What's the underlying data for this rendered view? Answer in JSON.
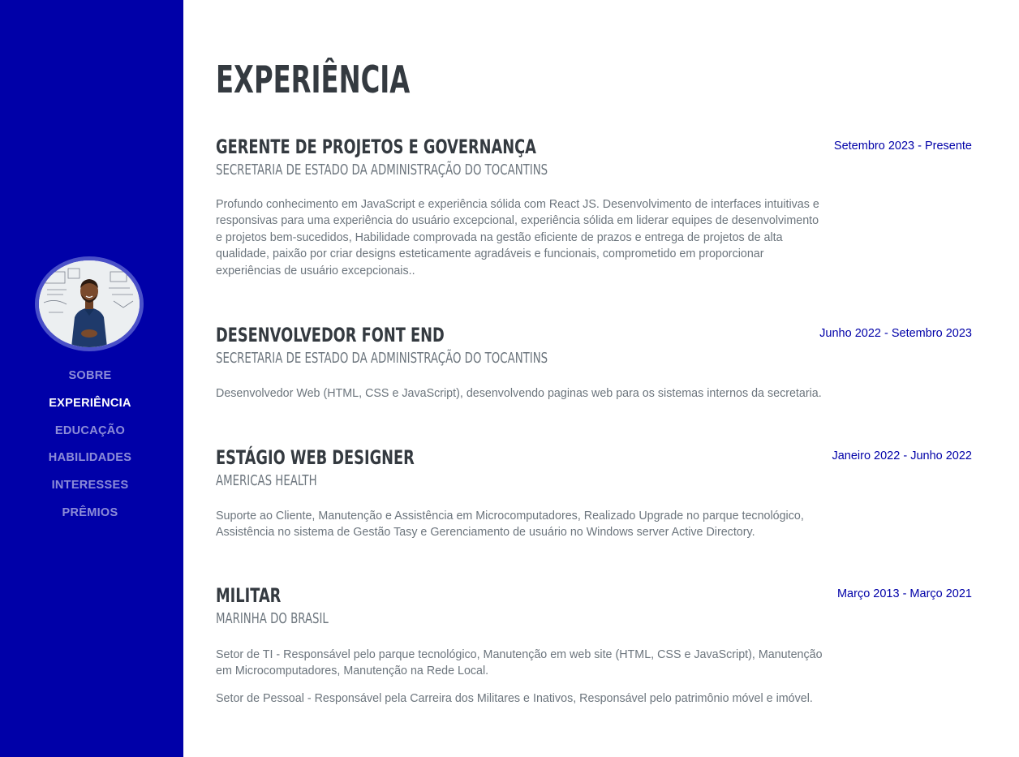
{
  "sidebar": {
    "nav": [
      {
        "label": "SOBRE"
      },
      {
        "label": "EXPERIÊNCIA",
        "active": true
      },
      {
        "label": "EDUCAÇÃO"
      },
      {
        "label": "HABILIDADES"
      },
      {
        "label": "INTERESSES"
      },
      {
        "label": "PRÊMIOS"
      }
    ],
    "colors": {
      "background": "#0000a8",
      "active": "#ffffff",
      "inactive": "#9aa0e0"
    }
  },
  "section": {
    "title": "EXPERIÊNCIA",
    "items": [
      {
        "title": "GERENTE DE PROJETOS E GOVERNANÇA",
        "subtitle": "SECRETARIA DE ESTADO DA ADMINISTRAÇÃO DO TOCANTINS",
        "date": "Setembro 2023 - Presente",
        "paragraphs": [
          "Profundo conhecimento em JavaScript e experiência sólida com React JS. Desenvolvimento de interfaces intuitivas e responsivas para uma experiência do usuário excepcional, experiência sólida em liderar equipes de desenvolvimento e projetos bem-sucedidos, Habilidade comprovada na gestão eficiente de prazos e entrega de projetos de alta qualidade, paixão por criar designs esteticamente agradáveis e funcionais, comprometido em proporcionar experiências de usuário excepcionais.."
        ]
      },
      {
        "title": "DESENVOLVEDOR FONT END",
        "subtitle": "SECRETARIA DE ESTADO DA ADMINISTRAÇÃO DO TOCANTINS",
        "date": "Junho 2022 - Setembro 2023",
        "paragraphs": [
          "Desenvolvedor Web (HTML, CSS e JavaScript), desenvolvendo paginas web para os sistemas internos da secretaria."
        ]
      },
      {
        "title": "ESTÁGIO WEB DESIGNER",
        "subtitle": "AMERICAS HEALTH",
        "date": "Janeiro 2022 - Junho 2022",
        "paragraphs": [
          "Suporte ao Cliente, Manutenção e Assistência em Microcomputadores, Realizado Upgrade no parque tecnológico, Assistência no sistema de Gestão Tasy e Gerenciamento de usuário no Windows server Active Directory."
        ]
      },
      {
        "title": "MILITAR",
        "subtitle": "MARINHA DO BRASIL",
        "date": "Março 2013 - Março 2021",
        "paragraphs": [
          "Setor de TI - Responsável pelo parque tecnológico, Manutenção em web site (HTML, CSS e JavaScript), Manutenção em Microcomputadores, Manutenção na Rede Local.",
          "Setor de Pessoal - Responsável pela Carreira dos Militares e Inativos, Responsável pelo patrimônio móvel e imóvel."
        ]
      }
    ]
  }
}
